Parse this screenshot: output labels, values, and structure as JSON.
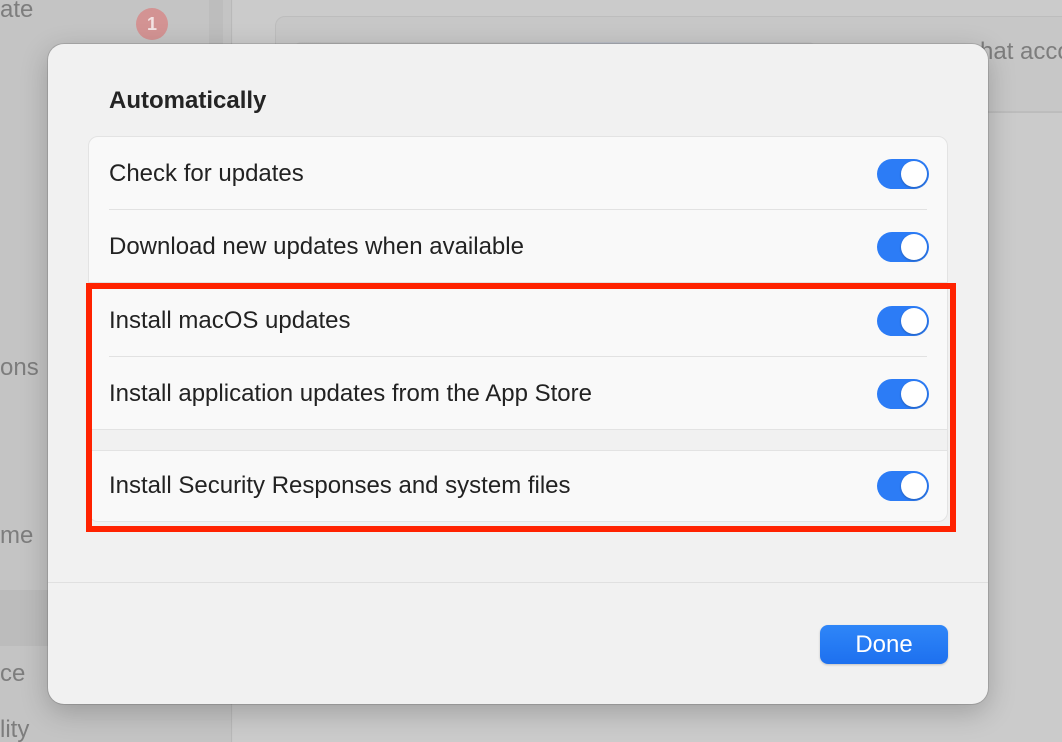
{
  "background": {
    "sidebar_fragments": [
      "ate",
      "ons",
      "me",
      "ce",
      "lity"
    ],
    "badge_count": "1",
    "card_text_fragment": "hat acco"
  },
  "dialog": {
    "section_title": "Automatically",
    "rows": [
      {
        "label": "Check for updates",
        "enabled": true
      },
      {
        "label": "Download new updates when available",
        "enabled": true
      },
      {
        "label": "Install macOS updates",
        "enabled": true
      },
      {
        "label": "Install application updates from the App Store",
        "enabled": true
      },
      {
        "label": "Install Security Responses and system files",
        "enabled": true
      }
    ],
    "done_label": "Done"
  },
  "colors": {
    "toggle_on": "#2c7cf6",
    "accent_button": "#1d70ef",
    "highlight": "#ff2200"
  }
}
